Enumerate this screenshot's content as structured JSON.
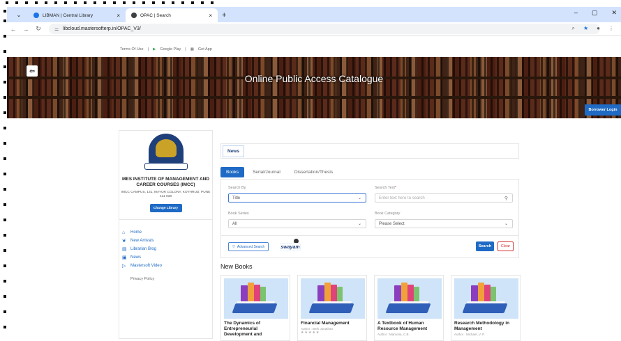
{
  "browser": {
    "tabs": [
      {
        "title": "LIBMAN | Central Library",
        "close": "×"
      },
      {
        "title": "OPAC | Search",
        "close": "×"
      }
    ],
    "new_tab": "+",
    "window_controls": [
      "–",
      "▢",
      "✕"
    ],
    "url": "libcloud.mastersofterp.in/OPAC_V3/"
  },
  "top_links": {
    "terms": "Terms Of Use",
    "sep1": "|",
    "google_play": "Google Play",
    "sep2": "|",
    "get_app": "Get App"
  },
  "banner": {
    "title": "Online Public Access Catalogue",
    "borrower_login": "Borrower Login"
  },
  "sidebar": {
    "org_name": "MES INSTITUTE OF MANAGEMENT AND CAREER COURSES (IMCC)",
    "org_address": "IMCC CAMPUS, 131, MAYUR COLONY, KOTHRUD, PUNE 411 038",
    "change_library": "Change Library",
    "menu": [
      {
        "label": "Home",
        "icon": "home-icon"
      },
      {
        "label": "New Arrivals",
        "icon": "gift-icon"
      },
      {
        "label": "Librarian Blog",
        "icon": "blog-icon"
      },
      {
        "label": "News",
        "icon": "news-icon"
      },
      {
        "label": "Mastersoft Video",
        "icon": "video-icon"
      }
    ],
    "privacy": "Privacy Policy"
  },
  "news": {
    "tab": "News"
  },
  "search": {
    "tabs": [
      "Books",
      "Serial/Journal",
      "Dissertation/Thesis"
    ],
    "search_by_label": "Search By",
    "search_by_value": "Title",
    "search_text_label": "Search Text",
    "search_text_required": "*",
    "search_text_placeholder": "Enter text here to search",
    "book_series_label": "Book Series",
    "book_series_value": "All",
    "book_category_label": "Book Category",
    "book_category_value": "Please Select",
    "advanced_search": "Advanced Search",
    "swayam": "swayam",
    "search_btn": "Search",
    "clear_btn": "Clear"
  },
  "new_books": {
    "title": "New Books",
    "items": [
      {
        "title": "The Dynamics of Entrepreneurial Development and",
        "author": "",
        "stars": ""
      },
      {
        "title": "Financial Management",
        "author": "Author : Berk Jonathan",
        "stars": "★★★★★"
      },
      {
        "title": "A Textbook of Human Resource Management",
        "author": "Author : Mamoria, C.B.",
        "stars": ""
      },
      {
        "title": "Research Methodology in Management",
        "author": "Author : Michael, V. P.",
        "stars": ""
      }
    ]
  },
  "colors": {
    "accent": "#1e6ac4",
    "clear": "#d32f2f",
    "tabbar": "#d3e3fd"
  }
}
